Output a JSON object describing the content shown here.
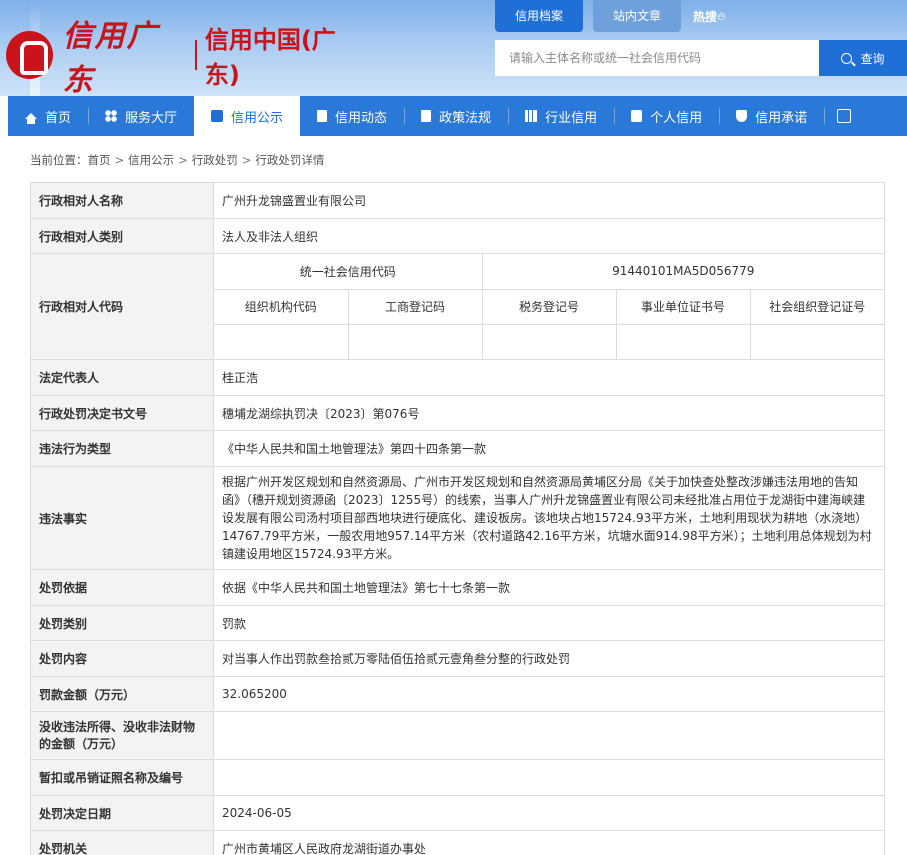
{
  "header": {
    "logo_cursive": "信用广东",
    "logo_main": "信用中国(广东)",
    "top_tabs": [
      "信用档案",
      "站内文章"
    ],
    "hot_label": "热搜",
    "search_placeholder": "请输入主体名称或统一社会信用代码",
    "search_button": "查询"
  },
  "nav": {
    "items": [
      {
        "label": "首页",
        "icon": "home-icon"
      },
      {
        "label": "服务大厅",
        "icon": "grid-icon"
      },
      {
        "label": "信用公示",
        "icon": "briefcase-icon"
      },
      {
        "label": "信用动态",
        "icon": "document-icon"
      },
      {
        "label": "政策法规",
        "icon": "book-icon"
      },
      {
        "label": "行业信用",
        "icon": "bar-chart-icon"
      },
      {
        "label": "个人信用",
        "icon": "person-card-icon"
      },
      {
        "label": "信用承诺",
        "icon": "shield-check-icon"
      }
    ],
    "active": "信用公示"
  },
  "breadcrumb": {
    "prefix": "当前位置：",
    "items": [
      "首页",
      "信用公示",
      "行政处罚",
      "行政处罚详情"
    ]
  },
  "detail": {
    "rows": [
      {
        "label": "行政相对人名称",
        "value": "广州升龙锦盛置业有限公司"
      },
      {
        "label": "行政相对人类别",
        "value": "法人及非法人组织"
      }
    ],
    "code_row": {
      "label": "行政相对人代码",
      "uscc_label": "统一社会信用代码",
      "uscc_value": "91440101MA5D056779",
      "sub_labels": [
        "组织机构代码",
        "工商登记码",
        "税务登记号",
        "事业单位证书号",
        "社会组织登记证号"
      ]
    },
    "rows2": [
      {
        "label": "法定代表人",
        "value": "桂正浩"
      },
      {
        "label": "行政处罚决定书文号",
        "value": "穗埔龙湖综执罚决〔2023〕第076号"
      },
      {
        "label": "违法行为类型",
        "value": "《中华人民共和国土地管理法》第四十四条第一款"
      },
      {
        "label": "违法事实",
        "value": "根据广州开发区规划和自然资源局、广州市开发区规划和自然资源局黄埔区分局《关于加快查处整改涉嫌违法用地的告知函》（穗开规划资源函〔2023〕1255号）的线索，当事人广州升龙锦盛置业有限公司未经批准占用位于龙湖街中建海峡建设发展有限公司汤村项目部西地块进行硬底化、建设板房。该地块占地15724.93平方米，土地利用现状为耕地（水浇地）14767.79平方米，一般农用地957.14平方米（农村道路42.16平方米，坑塘水面914.98平方米）；土地利用总体规划为村镇建设用地区15724.93平方米。"
      },
      {
        "label": "处罚依据",
        "value": "依据《中华人民共和国土地管理法》第七十七条第一款"
      },
      {
        "label": "处罚类别",
        "value": "罚款"
      },
      {
        "label": "处罚内容",
        "value": "对当事人作出罚款叁拾贰万零陆佰伍拾贰元壹角叁分整的行政处罚"
      },
      {
        "label": "罚款金额（万元）",
        "value": "32.065200"
      },
      {
        "label": "没收违法所得、没收非法财物的金额（万元）",
        "value": ""
      },
      {
        "label": "暂扣或吊销证照名称及编号",
        "value": ""
      },
      {
        "label": "处罚决定日期",
        "value": "2024-06-05"
      },
      {
        "label": "处罚机关",
        "value": "广州市黄埔区人民政府龙湖街道办事处"
      }
    ]
  }
}
